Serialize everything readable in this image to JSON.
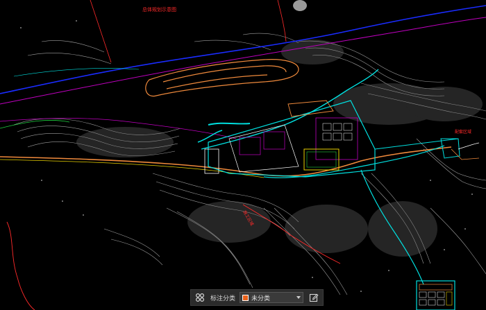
{
  "canvas": {
    "background": "#000000",
    "map_labels": [
      "总体规划示意图",
      "配套区域",
      "施工区域"
    ]
  },
  "toolbar": {
    "grid_icon": "grid-icon",
    "category_label": "标注分类",
    "selected_category": "未分类",
    "category_color": "#e8611a",
    "edit_icon": "edit-icon"
  },
  "colors": {
    "contour": "#cfcfcf",
    "road_cyan": "#00e0e0",
    "road_magenta": "#c000c0",
    "road_orange": "#f08a3c",
    "road_blue": "#1a2cff",
    "boundary_red": "#ff2a2a",
    "building_white": "#ffffff",
    "green": "#20d040",
    "yellow": "#e8d000"
  }
}
